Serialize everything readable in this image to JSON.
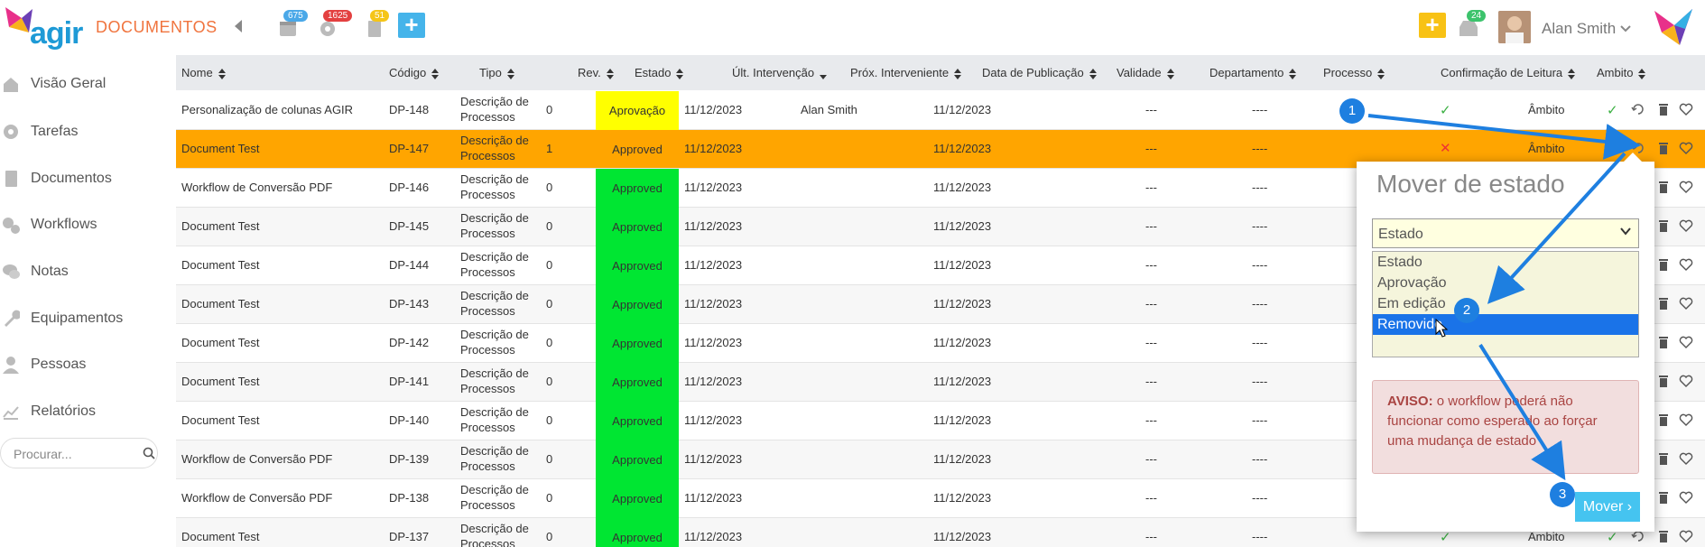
{
  "header": {
    "app_title": "DOCUMENTOS",
    "logo_text": "agir",
    "badges": {
      "calendar": "675",
      "alerts": "1625",
      "docs": "51",
      "inbox": "24"
    },
    "user_name": "Alan Smith"
  },
  "sidebar": {
    "items": [
      {
        "label": "Visão Geral",
        "icon": "home-icon"
      },
      {
        "label": "Tarefas",
        "icon": "gear-icon"
      },
      {
        "label": "Documentos",
        "icon": "document-icon"
      },
      {
        "label": "Workflows",
        "icon": "gears-icon"
      },
      {
        "label": "Notas",
        "icon": "comments-icon"
      },
      {
        "label": "Equipamentos",
        "icon": "wrench-icon"
      },
      {
        "label": "Pessoas",
        "icon": "person-icon"
      },
      {
        "label": "Relatórios",
        "icon": "chart-icon"
      }
    ],
    "search_placeholder": "Procurar..."
  },
  "table": {
    "columns": [
      "Nome",
      "Código",
      "Tipo",
      "Rev.",
      "Estado",
      "Últ. Intervenção",
      "Próx. Interveniente",
      "Data de Publicação",
      "Validade",
      "Departamento",
      "Processo",
      "Confirmação de Leitura",
      "Ambito"
    ],
    "rows": [
      {
        "nome": "Personalização de colunas AGIR",
        "codigo": "DP-148",
        "tipo": "Descrição de Processos",
        "rev": "0",
        "estado": "Aprovação",
        "ult": "11/12/2023",
        "prox": "Alan Smith",
        "data": "11/12/2023",
        "validade": "---",
        "depto": "----",
        "conf": "check",
        "ambito": "Âmbito"
      },
      {
        "nome": "Document Test",
        "codigo": "DP-147",
        "tipo": "Descrição de Processos",
        "rev": "1",
        "estado": "Approved",
        "ult": "11/12/2023",
        "prox": "",
        "data": "11/12/2023",
        "validade": "---",
        "depto": "----",
        "conf": "x",
        "ambito": "Âmbito"
      },
      {
        "nome": "Workflow de Conversão PDF",
        "codigo": "DP-146",
        "tipo": "Descrição de Processos",
        "rev": "0",
        "estado": "Approved",
        "ult": "11/12/2023",
        "prox": "",
        "data": "11/12/2023",
        "validade": "---",
        "depto": "----",
        "conf": "",
        "ambito": ""
      },
      {
        "nome": "Document Test",
        "codigo": "DP-145",
        "tipo": "Descrição de Processos",
        "rev": "0",
        "estado": "Approved",
        "ult": "11/12/2023",
        "prox": "",
        "data": "11/12/2023",
        "validade": "---",
        "depto": "----",
        "conf": "",
        "ambito": ""
      },
      {
        "nome": "Document Test",
        "codigo": "DP-144",
        "tipo": "Descrição de Processos",
        "rev": "0",
        "estado": "Approved",
        "ult": "11/12/2023",
        "prox": "",
        "data": "11/12/2023",
        "validade": "---",
        "depto": "----",
        "conf": "",
        "ambito": ""
      },
      {
        "nome": "Document Test",
        "codigo": "DP-143",
        "tipo": "Descrição de Processos",
        "rev": "0",
        "estado": "Approved",
        "ult": "11/12/2023",
        "prox": "",
        "data": "11/12/2023",
        "validade": "---",
        "depto": "----",
        "conf": "",
        "ambito": ""
      },
      {
        "nome": "Document Test",
        "codigo": "DP-142",
        "tipo": "Descrição de Processos",
        "rev": "0",
        "estado": "Approved",
        "ult": "11/12/2023",
        "prox": "",
        "data": "11/12/2023",
        "validade": "---",
        "depto": "----",
        "conf": "",
        "ambito": ""
      },
      {
        "nome": "Document Test",
        "codigo": "DP-141",
        "tipo": "Descrição de Processos",
        "rev": "0",
        "estado": "Approved",
        "ult": "11/12/2023",
        "prox": "",
        "data": "11/12/2023",
        "validade": "---",
        "depto": "----",
        "conf": "",
        "ambito": ""
      },
      {
        "nome": "Document Test",
        "codigo": "DP-140",
        "tipo": "Descrição de Processos",
        "rev": "0",
        "estado": "Approved",
        "ult": "11/12/2023",
        "prox": "",
        "data": "11/12/2023",
        "validade": "---",
        "depto": "----",
        "conf": "",
        "ambito": ""
      },
      {
        "nome": "Workflow de Conversão PDF",
        "codigo": "DP-139",
        "tipo": "Descrição de Processos",
        "rev": "0",
        "estado": "Approved",
        "ult": "11/12/2023",
        "prox": "",
        "data": "11/12/2023",
        "validade": "---",
        "depto": "----",
        "conf": "",
        "ambito": ""
      },
      {
        "nome": "Workflow de Conversão PDF",
        "codigo": "DP-138",
        "tipo": "Descrição de Processos",
        "rev": "0",
        "estado": "Approved",
        "ult": "11/12/2023",
        "prox": "",
        "data": "11/12/2023",
        "validade": "---",
        "depto": "----",
        "conf": "",
        "ambito": ""
      },
      {
        "nome": "Document Test",
        "codigo": "DP-137",
        "tipo": "Descrição de Processos",
        "rev": "0",
        "estado": "Approved",
        "ult": "11/12/2023",
        "prox": "",
        "data": "11/12/2023",
        "validade": "---",
        "depto": "----",
        "conf": "check",
        "ambito": "Âmbito"
      }
    ]
  },
  "popup": {
    "title": "Mover de estado",
    "select_value": "Estado",
    "options": [
      "Estado",
      "Aprovação",
      "Em edição",
      "Removido"
    ],
    "highlighted_option": "Removido",
    "warning_label": "AVISO:",
    "warning_text": "o workflow poderá não funcionar como esperado ao forçar uma mudança de estado",
    "move_button": "Mover"
  },
  "annotations": {
    "steps": [
      "1",
      "2",
      "3"
    ]
  },
  "colors": {
    "accent_blue": "#1e9ad6",
    "title_orange": "#f0743e",
    "selected_row": "#ffa500",
    "approved_green": "#00e632",
    "pending_yellow": "#ffff00",
    "arrow_blue": "#1e7fe0"
  }
}
